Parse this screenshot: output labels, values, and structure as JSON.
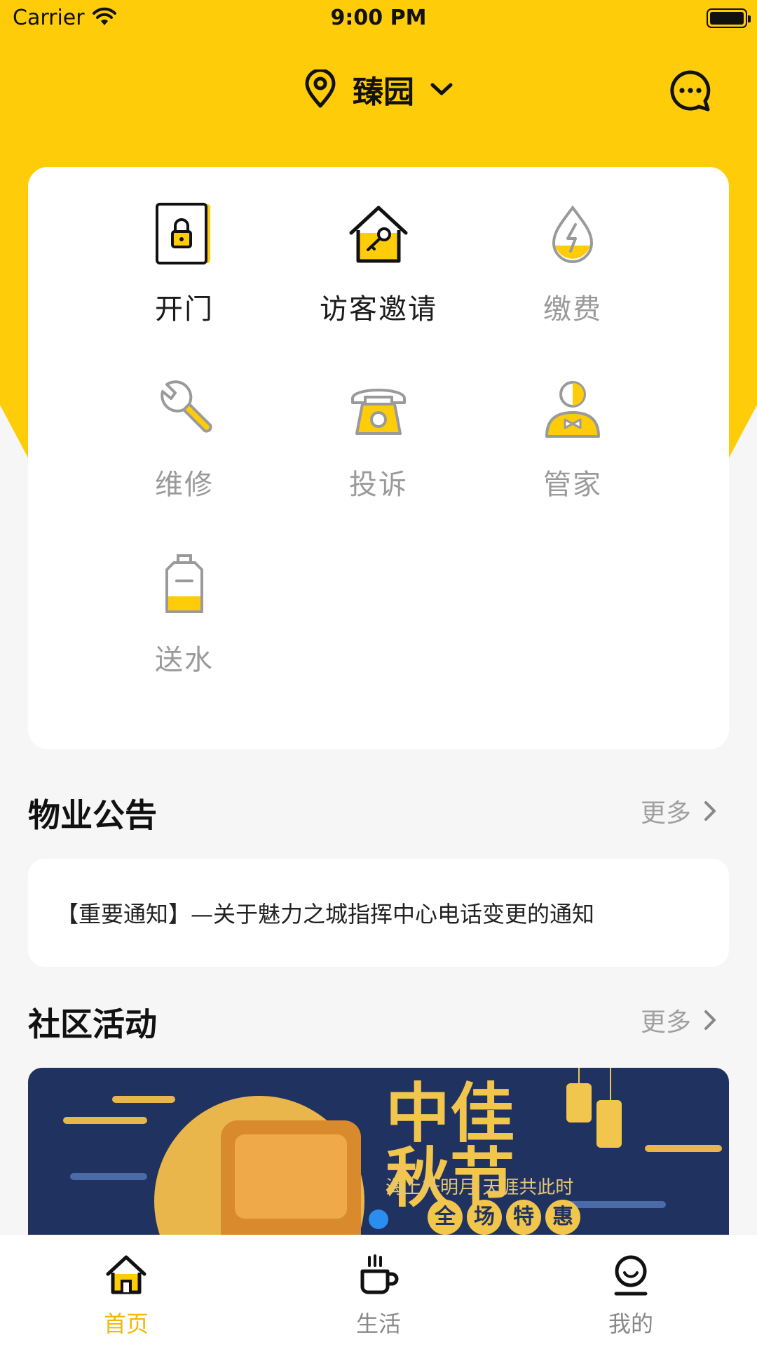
{
  "status_bar": {
    "carrier": "Carrier",
    "time": "9:00 PM"
  },
  "header": {
    "location": "臻园"
  },
  "services": [
    {
      "label": "开门",
      "icon": "door-lock-icon"
    },
    {
      "label": "访客邀请",
      "icon": "house-key-icon"
    },
    {
      "label": "缴费",
      "icon": "power-drop-icon"
    },
    {
      "label": "维修",
      "icon": "wrench-icon"
    },
    {
      "label": "投诉",
      "icon": "telephone-icon"
    },
    {
      "label": "管家",
      "icon": "butler-icon"
    },
    {
      "label": "送水",
      "icon": "water-bottle-icon"
    }
  ],
  "notice_section": {
    "title": "物业公告",
    "more": "更多",
    "notice": "【重要通知】—关于魅力之城指挥中心电话变更的通知"
  },
  "activity_section": {
    "title": "社区活动",
    "more": "更多",
    "banner": {
      "title_line1": "中佳",
      "title_line2": "秋节",
      "subtitle": "海上升明月 天涯共此时",
      "badge": [
        "全",
        "场",
        "特",
        "惠"
      ]
    }
  },
  "tab_bar": [
    {
      "label": "首页",
      "icon": "home-icon",
      "active": true
    },
    {
      "label": "生活",
      "icon": "coffee-cup-icon",
      "active": false
    },
    {
      "label": "我的",
      "icon": "user-smile-icon",
      "active": false
    }
  ],
  "colors": {
    "brand_yellow": "#fecc09",
    "active_tab": "#f5b800",
    "page_dot": "#2b8df0"
  }
}
